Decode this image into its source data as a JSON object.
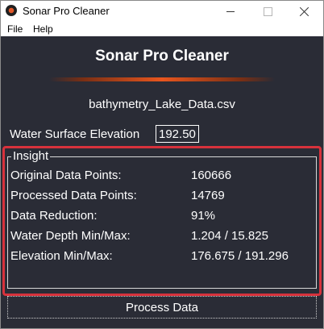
{
  "window": {
    "title": "Sonar Pro Cleaner"
  },
  "menu": {
    "items": [
      "File",
      "Help"
    ]
  },
  "header": {
    "title": "Sonar Pro Cleaner"
  },
  "file": {
    "name": "bathymetry_Lake_Data.csv"
  },
  "water_surface": {
    "label": "Water Surface Elevation",
    "value": "192.50"
  },
  "insight": {
    "title": "Insight",
    "rows": [
      {
        "label": "Original Data Points:",
        "value": "160666"
      },
      {
        "label": "Processed Data Points:",
        "value": "14769"
      },
      {
        "label": "Data Reduction:",
        "value": "91%"
      },
      {
        "label": "Water Depth Min/Max:",
        "value": "1.204 / 15.825"
      },
      {
        "label": "Elevation Min/Max:",
        "value": "176.675 / 191.296"
      }
    ]
  },
  "actions": {
    "process_label": "Process Data"
  },
  "colors": {
    "background": "#2a2c36",
    "accent": "#e8561e",
    "highlight": "#d7323c"
  }
}
